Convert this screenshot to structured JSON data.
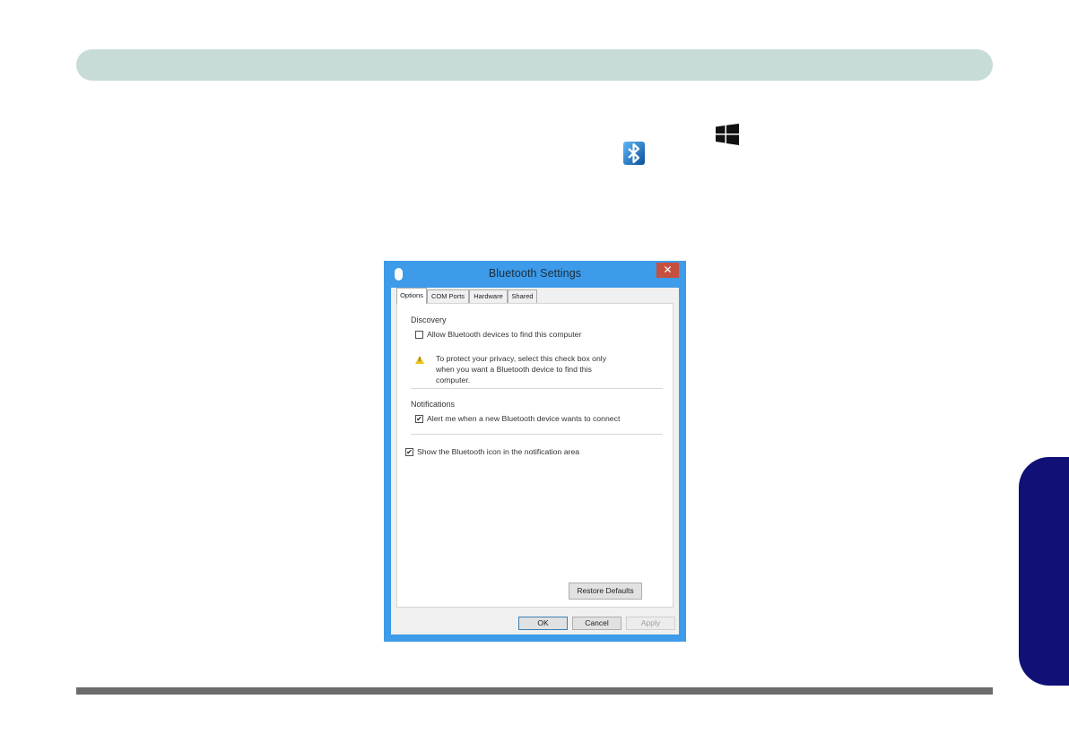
{
  "dialog": {
    "title": "Bluetooth Settings",
    "close_glyph": "✕",
    "tabs": [
      "Options",
      "COM Ports",
      "Hardware",
      "Shared"
    ],
    "active_tab": "Options",
    "discovery": {
      "heading": "Discovery",
      "allow_label": "Allow Bluetooth devices to find this computer",
      "allow_checked": false,
      "warning_lines": [
        "To protect your privacy, select this check box only",
        "when you want a Bluetooth device to find this",
        "computer."
      ]
    },
    "notifications": {
      "heading": "Notifications",
      "alert_label": "Alert me when a new Bluetooth device wants to connect",
      "alert_checked": true
    },
    "show_icon_label": "Show the Bluetooth icon in the notification area",
    "show_icon_checked": true,
    "restore_defaults": "Restore Defaults",
    "ok": "OK",
    "cancel": "Cancel",
    "apply": "Apply",
    "check_glyph": "✔"
  },
  "icons": [
    "windows-logo-icon",
    "bluetooth-icon",
    "warning-icon"
  ],
  "colors": {
    "header_bar": "#c7dcd8",
    "side_tab": "#101077",
    "dialog_frame": "#3d9be9",
    "close_button": "#c74f3e"
  }
}
